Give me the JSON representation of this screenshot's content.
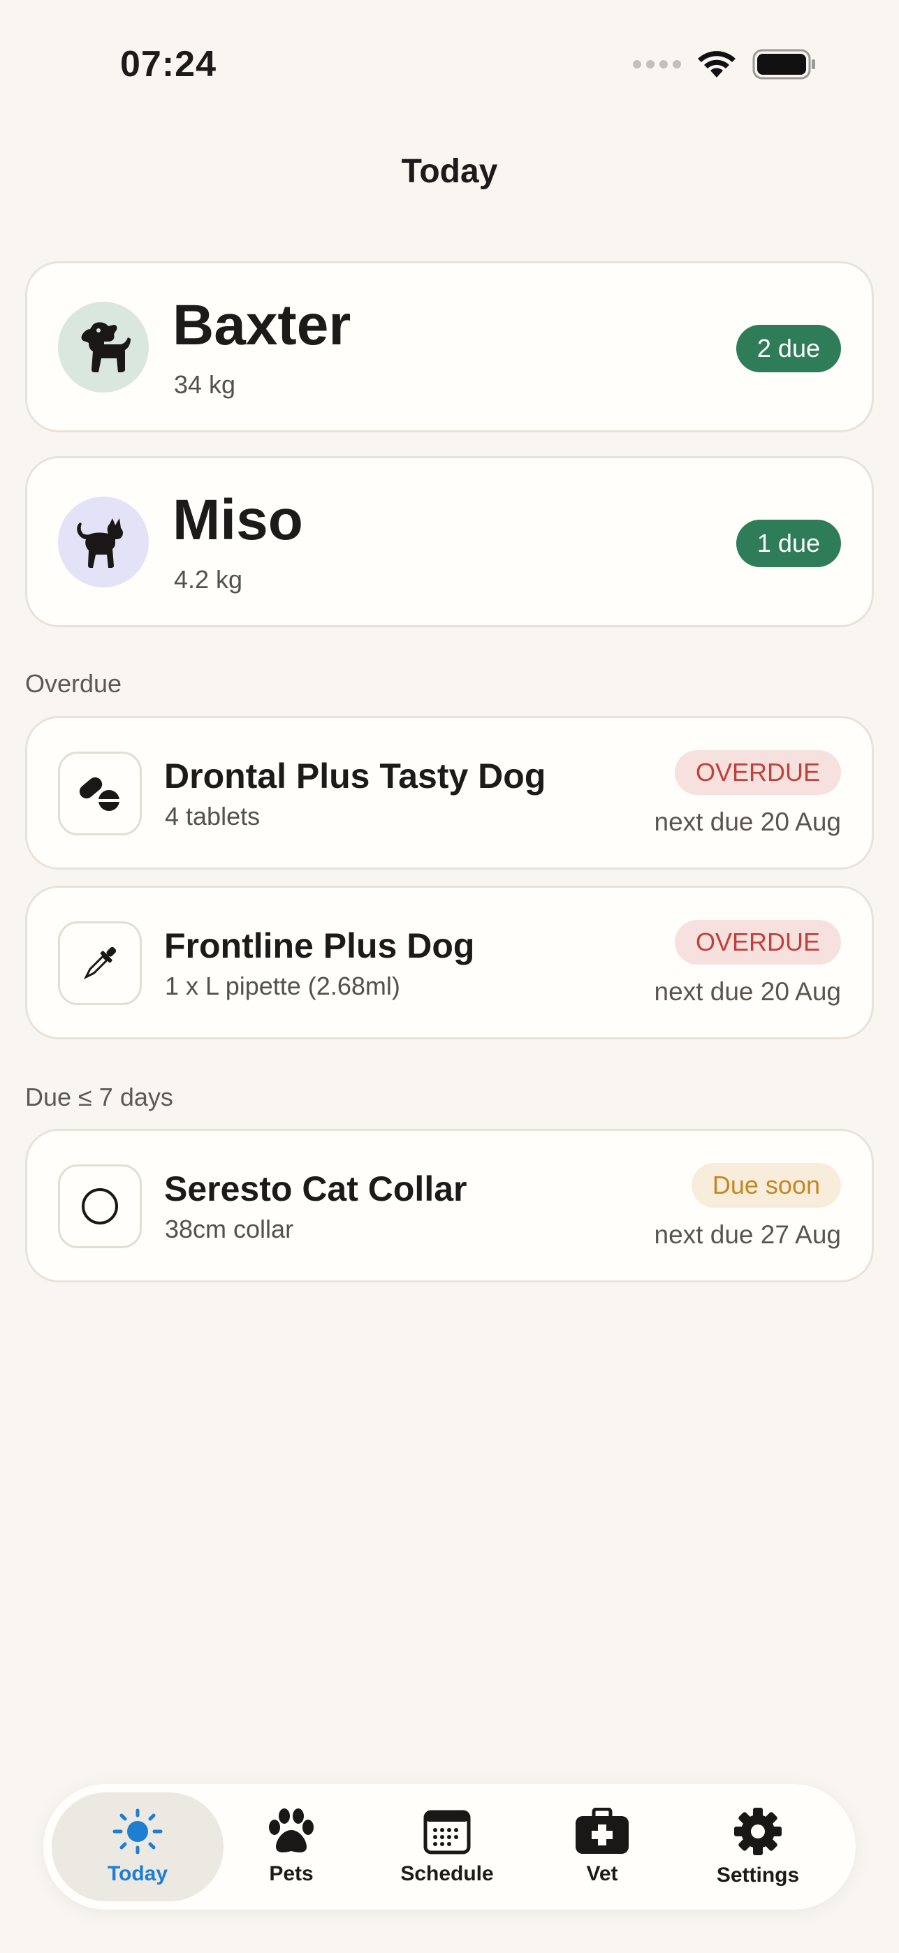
{
  "status_bar": {
    "time": "07:24"
  },
  "header": {
    "title": "Today"
  },
  "pets": [
    {
      "name": "Baxter",
      "weight": "34 kg",
      "due": "2 due",
      "avatar_icon": "dog-icon",
      "avatar_color": "#D9E7DF"
    },
    {
      "name": "Miso",
      "weight": "4.2 kg",
      "due": "1 due",
      "avatar_icon": "cat-icon",
      "avatar_color": "#E4E2F7"
    }
  ],
  "sections": {
    "overdue": {
      "label": "Overdue",
      "items": [
        {
          "name": "Drontal Plus Tasty Dog",
          "dose": "4 tablets",
          "status": "OVERDUE",
          "next_due": "next due 20 Aug",
          "icon": "pills-icon"
        },
        {
          "name": "Frontline Plus Dog",
          "dose": "1 x L pipette (2.68ml)",
          "status": "OVERDUE",
          "next_due": "next due 20 Aug",
          "icon": "pipette-icon"
        }
      ]
    },
    "due_soon": {
      "label": "Due ≤ 7 days",
      "items": [
        {
          "name": "Seresto Cat Collar",
          "dose": "38cm collar",
          "status": "Due soon",
          "next_due": "next due 27 Aug",
          "icon": "collar-icon"
        }
      ]
    }
  },
  "tab_bar": {
    "active": "Today",
    "tabs": [
      {
        "label": "Today",
        "icon": "sun-icon"
      },
      {
        "label": "Pets",
        "icon": "paw-icon"
      },
      {
        "label": "Schedule",
        "icon": "calendar-icon"
      },
      {
        "label": "Vet",
        "icon": "medkit-icon"
      },
      {
        "label": "Settings",
        "icon": "gear-icon"
      }
    ]
  },
  "colors": {
    "background": "#F9F6F1",
    "accent_green": "#2F7D58",
    "overdue_red": "#C2403A",
    "due_soon_amber": "#C48721",
    "active_tab_blue": "#1E7ED2"
  }
}
